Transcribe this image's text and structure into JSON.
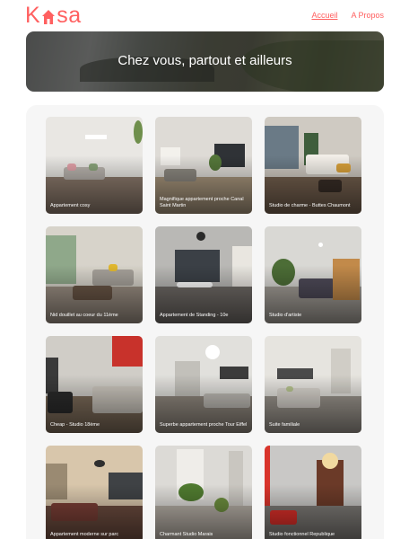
{
  "logo": {
    "text_before": "K",
    "text_after": "sa"
  },
  "nav": {
    "home_label": "Accueil",
    "about_label": "A Propos"
  },
  "hero": {
    "title": "Chez vous, partout et ailleurs"
  },
  "listings": [
    {
      "title": "Appartement cosy"
    },
    {
      "title": "Magnifique appartement proche Canal Saint Martin"
    },
    {
      "title": "Studio de charme - Buttes Chaumont"
    },
    {
      "title": "Nid douillet au coeur du 11ème"
    },
    {
      "title": "Appartement de Standing - 10e"
    },
    {
      "title": "Studio d'artiste"
    },
    {
      "title": "Cheap - Studio 18ème"
    },
    {
      "title": "Superbe appartement proche Tour Eiffel"
    },
    {
      "title": "Suite familiale"
    },
    {
      "title": "Appartement moderne sur parc"
    },
    {
      "title": "Charmant Studio Marais"
    },
    {
      "title": "Studio fonctionnel Republique"
    }
  ],
  "colors": {
    "brand": "#ff6060",
    "gallery_bg": "#f6f6f6"
  }
}
